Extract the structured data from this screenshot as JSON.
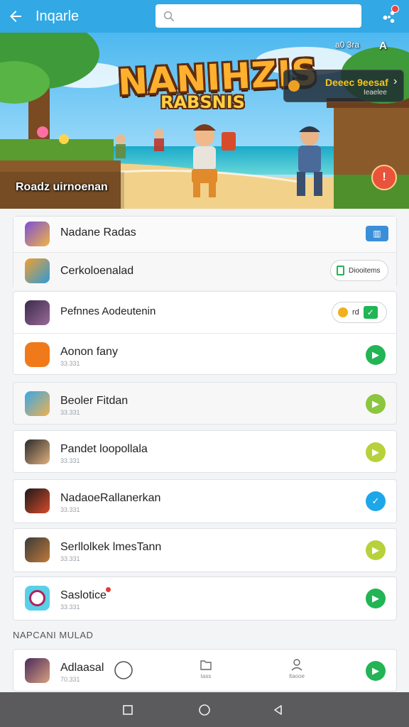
{
  "header": {
    "title": "Inqarle",
    "search_placeholder": "",
    "back_icon": "arrow-left-icon",
    "menu_icon": "share-nodes-icon"
  },
  "banner": {
    "title": "NANIHZIS",
    "subtitle": "RABSNIS",
    "caption": "Roadz uirnoenan",
    "code": "a0 3ra",
    "code_icon": "A",
    "promo_title": "Deeec 9eesaf",
    "promo_sub": "Ieaelee",
    "badge": "!"
  },
  "group1": [
    {
      "name": "Nadane Radas",
      "action": "book"
    },
    {
      "name": "Cerkoloenalad",
      "action_label": "Diooitems"
    }
  ],
  "group2": [
    {
      "name": "Pefnnes Aodeutenin",
      "action_label": "rd"
    },
    {
      "name": "Aonon fany",
      "sub": "33.331",
      "action_color": "#22b455"
    }
  ],
  "apps": [
    {
      "name": "Beoler Fitdan",
      "sub": "33.331",
      "action_color": "#8cc63f"
    },
    {
      "name": "Pandet loopollala",
      "sub": "33.331",
      "action_color": "#b7d13b"
    },
    {
      "name": "NadaoeRallanerkan",
      "sub": "33.331",
      "action_color": "#1ea7e8"
    },
    {
      "name": "Serllolkek lmesTann",
      "sub": "33.331",
      "action_color": "#b7d13b"
    },
    {
      "name": "Saslotice",
      "sub": "33.331",
      "action_color": "#22b455"
    }
  ],
  "section_label": "NAPCANI MULAD",
  "bottom_app": {
    "name": "Adlaasal",
    "sub": "70.331",
    "tab1": "",
    "tab2": "tass",
    "tab3": "ltaooe",
    "action_color": "#22b455"
  },
  "colors": {
    "accent": "#32a8e4",
    "green": "#22b455",
    "navbar": "#5b5b5d"
  }
}
